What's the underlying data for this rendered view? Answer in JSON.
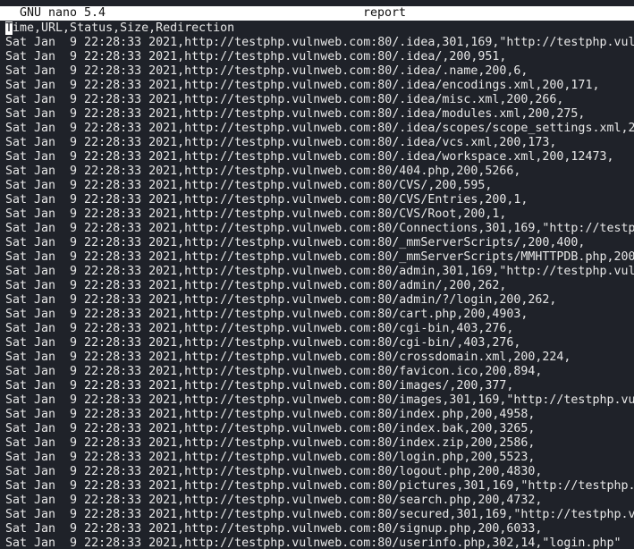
{
  "titlebar": {
    "app_name": "GNU nano 5.4",
    "file_name": "report"
  },
  "buffer": {
    "cursor_char": "T",
    "header_rest": "ime,URL,Status,Size,Redirection",
    "lines": [
      "Sat Jan  9 22:28:33 2021,http://testphp.vulnweb.com:80/.idea,301,169,\"http://testphp.vul",
      "Sat Jan  9 22:28:33 2021,http://testphp.vulnweb.com:80/.idea/,200,951,",
      "Sat Jan  9 22:28:33 2021,http://testphp.vulnweb.com:80/.idea/.name,200,6,",
      "Sat Jan  9 22:28:33 2021,http://testphp.vulnweb.com:80/.idea/encodings.xml,200,171,",
      "Sat Jan  9 22:28:33 2021,http://testphp.vulnweb.com:80/.idea/misc.xml,200,266,",
      "Sat Jan  9 22:28:33 2021,http://testphp.vulnweb.com:80/.idea/modules.xml,200,275,",
      "Sat Jan  9 22:28:33 2021,http://testphp.vulnweb.com:80/.idea/scopes/scope_settings.xml,2",
      "Sat Jan  9 22:28:33 2021,http://testphp.vulnweb.com:80/.idea/vcs.xml,200,173,",
      "Sat Jan  9 22:28:33 2021,http://testphp.vulnweb.com:80/.idea/workspace.xml,200,12473,",
      "Sat Jan  9 22:28:33 2021,http://testphp.vulnweb.com:80/404.php,200,5266,",
      "Sat Jan  9 22:28:33 2021,http://testphp.vulnweb.com:80/CVS/,200,595,",
      "Sat Jan  9 22:28:33 2021,http://testphp.vulnweb.com:80/CVS/Entries,200,1,",
      "Sat Jan  9 22:28:33 2021,http://testphp.vulnweb.com:80/CVS/Root,200,1,",
      "Sat Jan  9 22:28:33 2021,http://testphp.vulnweb.com:80/Connections,301,169,\"http://testp",
      "Sat Jan  9 22:28:33 2021,http://testphp.vulnweb.com:80/_mmServerScripts/,200,400,",
      "Sat Jan  9 22:28:33 2021,http://testphp.vulnweb.com:80/_mmServerScripts/MMHTTPDB.php,200",
      "Sat Jan  9 22:28:33 2021,http://testphp.vulnweb.com:80/admin,301,169,\"http://testphp.vul",
      "Sat Jan  9 22:28:33 2021,http://testphp.vulnweb.com:80/admin/,200,262,",
      "Sat Jan  9 22:28:33 2021,http://testphp.vulnweb.com:80/admin/?/login,200,262,",
      "Sat Jan  9 22:28:33 2021,http://testphp.vulnweb.com:80/cart.php,200,4903,",
      "Sat Jan  9 22:28:33 2021,http://testphp.vulnweb.com:80/cgi-bin,403,276,",
      "Sat Jan  9 22:28:33 2021,http://testphp.vulnweb.com:80/cgi-bin/,403,276,",
      "Sat Jan  9 22:28:33 2021,http://testphp.vulnweb.com:80/crossdomain.xml,200,224,",
      "Sat Jan  9 22:28:33 2021,http://testphp.vulnweb.com:80/favicon.ico,200,894,",
      "Sat Jan  9 22:28:33 2021,http://testphp.vulnweb.com:80/images/,200,377,",
      "Sat Jan  9 22:28:33 2021,http://testphp.vulnweb.com:80/images,301,169,\"http://testphp.vu",
      "Sat Jan  9 22:28:33 2021,http://testphp.vulnweb.com:80/index.php,200,4958,",
      "Sat Jan  9 22:28:33 2021,http://testphp.vulnweb.com:80/index.bak,200,3265,",
      "Sat Jan  9 22:28:33 2021,http://testphp.vulnweb.com:80/index.zip,200,2586,",
      "Sat Jan  9 22:28:33 2021,http://testphp.vulnweb.com:80/login.php,200,5523,",
      "Sat Jan  9 22:28:33 2021,http://testphp.vulnweb.com:80/logout.php,200,4830,",
      "Sat Jan  9 22:28:33 2021,http://testphp.vulnweb.com:80/pictures,301,169,\"http://testphp.",
      "Sat Jan  9 22:28:33 2021,http://testphp.vulnweb.com:80/search.php,200,4732,",
      "Sat Jan  9 22:28:33 2021,http://testphp.vulnweb.com:80/secured,301,169,\"http://testphp.v",
      "Sat Jan  9 22:28:33 2021,http://testphp.vulnweb.com:80/signup.php,200,6033,",
      "Sat Jan  9 22:28:33 2021,http://testphp.vulnweb.com:80/userinfo.php,302,14,\"login.php\""
    ]
  },
  "colors": {
    "background": "#1f2229",
    "text": "#e8e8e8",
    "titlebar_bg": "#ffffff",
    "titlebar_text": "#111111"
  }
}
